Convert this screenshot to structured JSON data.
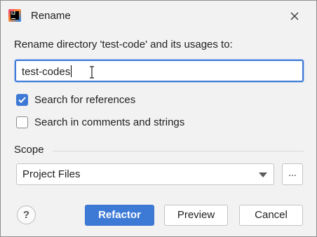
{
  "dialog": {
    "title": "Rename",
    "prompt": "Rename directory 'test-code' and its usages to:",
    "name_value": "test-codes"
  },
  "options": {
    "search_references": {
      "label": "Search for references",
      "checked": true
    },
    "search_comments": {
      "label": "Search in comments and strings",
      "checked": false
    }
  },
  "scope": {
    "title": "Scope",
    "selected": "Project Files",
    "more_label": "..."
  },
  "buttons": {
    "help": "?",
    "refactor": "Refactor",
    "preview": "Preview",
    "cancel": "Cancel"
  },
  "colors": {
    "accent": "#3d7ad6",
    "background": "#f2f2f2"
  },
  "icons": {
    "app": "intellij-app-icon",
    "close": "close-icon",
    "dropdown": "chevron-down-icon",
    "help": "help-icon",
    "cursor": "text-cursor-icon"
  }
}
